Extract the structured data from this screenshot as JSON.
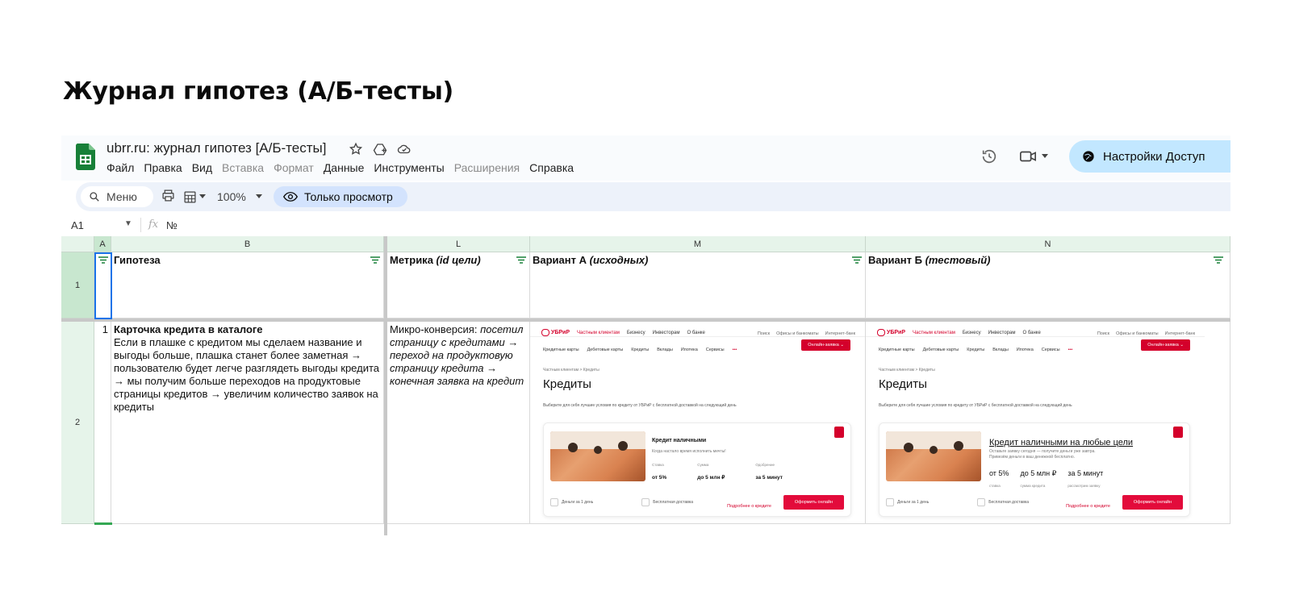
{
  "page_title": "Журнал гипотез (А/Б-тесты)",
  "app": {
    "doc_title": "ubrr.ru: журнал гипотез [А/Б-тесты]",
    "menu": [
      {
        "label": "Файл",
        "dim": false
      },
      {
        "label": "Правка",
        "dim": false
      },
      {
        "label": "Вид",
        "dim": false
      },
      {
        "label": "Вставка",
        "dim": true
      },
      {
        "label": "Формат",
        "dim": true
      },
      {
        "label": "Данные",
        "dim": false
      },
      {
        "label": "Инструменты",
        "dim": false
      },
      {
        "label": "Расширения",
        "dim": true
      },
      {
        "label": "Справка",
        "dim": false
      }
    ],
    "share_label": "Настройки Доступ",
    "search_label": "Меню",
    "zoom": "100%",
    "view_only_label": "Только просмотр",
    "cell_ref": "A1",
    "formula_value": "№"
  },
  "columns": {
    "a": "A",
    "b": "B",
    "l": "L",
    "m": "M",
    "n": "N"
  },
  "rows": {
    "r1": "1",
    "r2": "2"
  },
  "headers": {
    "b": "Гипотеза",
    "l_main": "Метрика ",
    "l_italic": "(id цели)",
    "m_main": "Вариант А ",
    "m_italic": "(исходных)",
    "n_main": "Вариант Б ",
    "n_italic": "(тестовый)"
  },
  "row2": {
    "num": "1",
    "hyp_title": "Карточка кредита в каталоге",
    "hyp_text": "Если в плашке с кредитом мы сделаем название и выгоды больше, плашка станет более заметная → пользователю будет легче разглядеть выгоды кредита → мы получим больше переходов на продуктовые страницы кредитов → увеличим количество заявок на кредиты",
    "metric_main": "Микро-конверсия: ",
    "metric_italic": "посетил страницу с кредитами → переход на продуктовую страницу кредита → конечная заявка на кредит"
  },
  "mock": {
    "logo": "УБРиР",
    "top_nav": [
      "Частным клиентам",
      "Бизнесу",
      "Инвесторам",
      "О банке"
    ],
    "top_right": [
      "Поиск",
      "Офисы и банкоматы",
      "Интернет-банк"
    ],
    "sub_nav": [
      "Кредитные карты",
      "Дебетовые карты",
      "Кредиты",
      "Вклады",
      "Ипотека",
      "Сервисы"
    ],
    "apply_btn": "Онлайн-заявка ⌄",
    "crumb": "Частным клиентам  >  Кредиты",
    "heading": "Кредиты",
    "subheading": "Выберите для себя лучшие условия по кредиту от УБРиР с бесплатной доставкой на следующий день",
    "footer_items": [
      "Деньги за 1 день",
      "Бесплатная доставка"
    ],
    "more_link": "Подробнее о кредите",
    "order_btn": "Оформить онлайн",
    "a": {
      "card_title": "Кредит наличными",
      "card_desc": "Когда настало время исполнить мечты!",
      "stats": [
        {
          "label": "Ставка",
          "value": "от 5%"
        },
        {
          "label": "Сумма",
          "value": "до 5 млн ₽"
        },
        {
          "label": "Одобрение",
          "value": "за 5 минут"
        }
      ]
    },
    "b": {
      "card_title": "Кредит наличными на любые цели",
      "card_desc": "Оставьте заявку сегодня — получите деньги уже завтра. Привезём деньги в ваш денежной бесплатно.",
      "stats": [
        {
          "label": "ставка",
          "value": "от 5%"
        },
        {
          "label": "сумма кредита",
          "value": "до 5 млн ₽"
        },
        {
          "label": "рассмотрим заявку",
          "value": "за 5 минут"
        }
      ]
    }
  },
  "colors": {
    "red": "#d4002b",
    "header_green": "#e6f4ea",
    "select_blue": "#1a73e8"
  }
}
